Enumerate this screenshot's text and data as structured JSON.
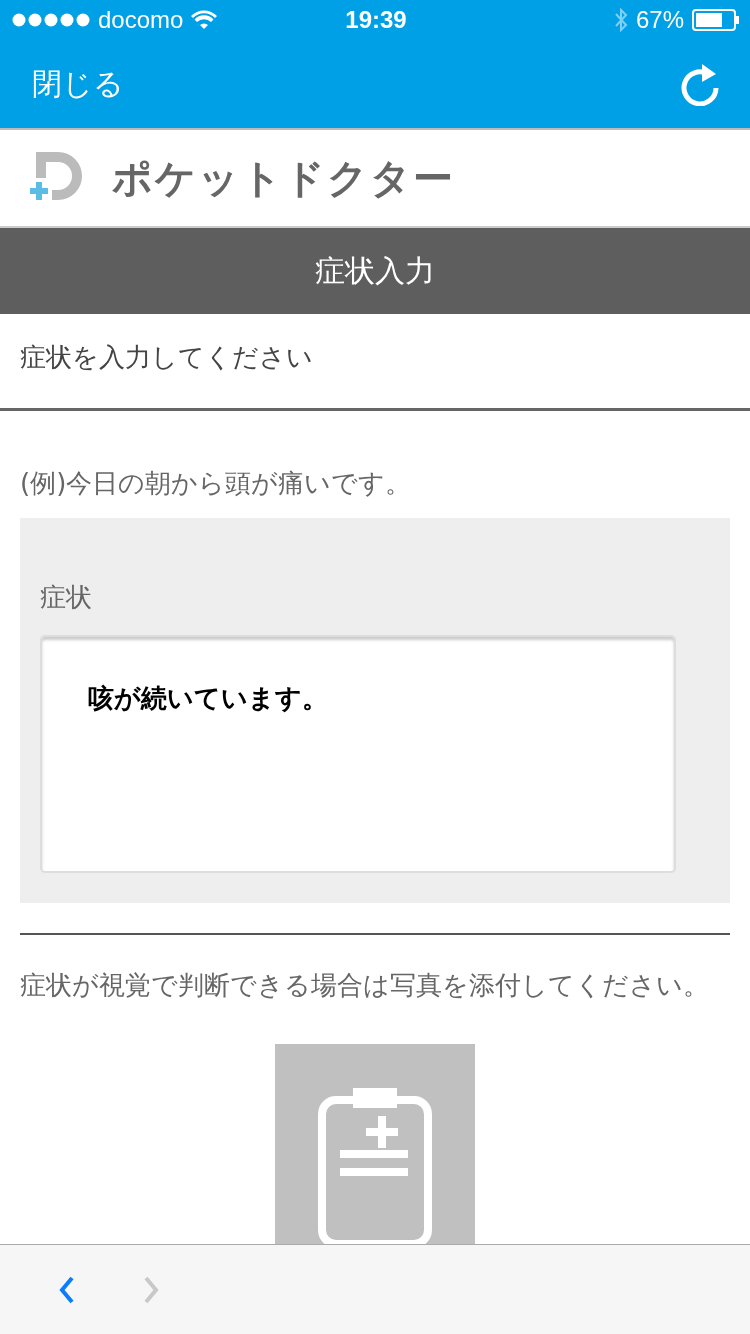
{
  "status_bar": {
    "carrier": "docomo",
    "time": "19:39",
    "battery": "67%"
  },
  "nav": {
    "close": "閉じる"
  },
  "brand": {
    "name": "ポケットドクター"
  },
  "section_title": "症状入力",
  "prompt": "症状を入力してください",
  "example": "(例)今日の朝から頭が痛いです。",
  "form": {
    "label": "症状",
    "value": "咳が続いています。"
  },
  "photo_note": "症状が視覚で判断できる場合は写真を添付してください。",
  "toolbar": [
    {
      "kind": "back",
      "disabled": false
    },
    {
      "kind": "forward",
      "disabled": true
    }
  ]
}
